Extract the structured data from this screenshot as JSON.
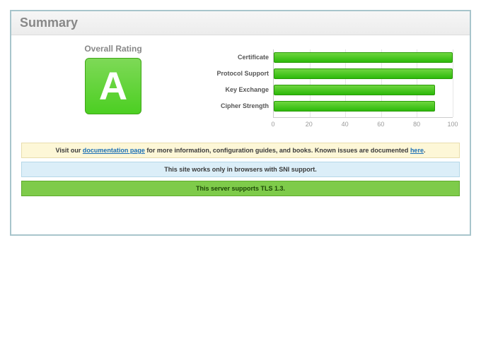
{
  "header": {
    "title": "Summary"
  },
  "rating": {
    "label": "Overall Rating",
    "grade": "A"
  },
  "chart_data": {
    "type": "bar",
    "orientation": "horizontal",
    "categories": [
      "Certificate",
      "Protocol Support",
      "Key Exchange",
      "Cipher Strength"
    ],
    "values": [
      100,
      100,
      90,
      90
    ],
    "title": "",
    "xlabel": "",
    "ylabel": "",
    "xlim": [
      0,
      100
    ],
    "x_ticks": [
      0,
      20,
      40,
      60,
      80,
      100
    ],
    "bar_color": "#3cc414"
  },
  "notices": {
    "doc": {
      "prefix": "Visit our ",
      "link1": "documentation page",
      "mid": " for more information, configuration guides, and books. Known issues are documented ",
      "link2": "here",
      "suffix": "."
    },
    "sni": "This site works only in browsers with SNI support.",
    "tls": "This server supports TLS 1.3."
  }
}
